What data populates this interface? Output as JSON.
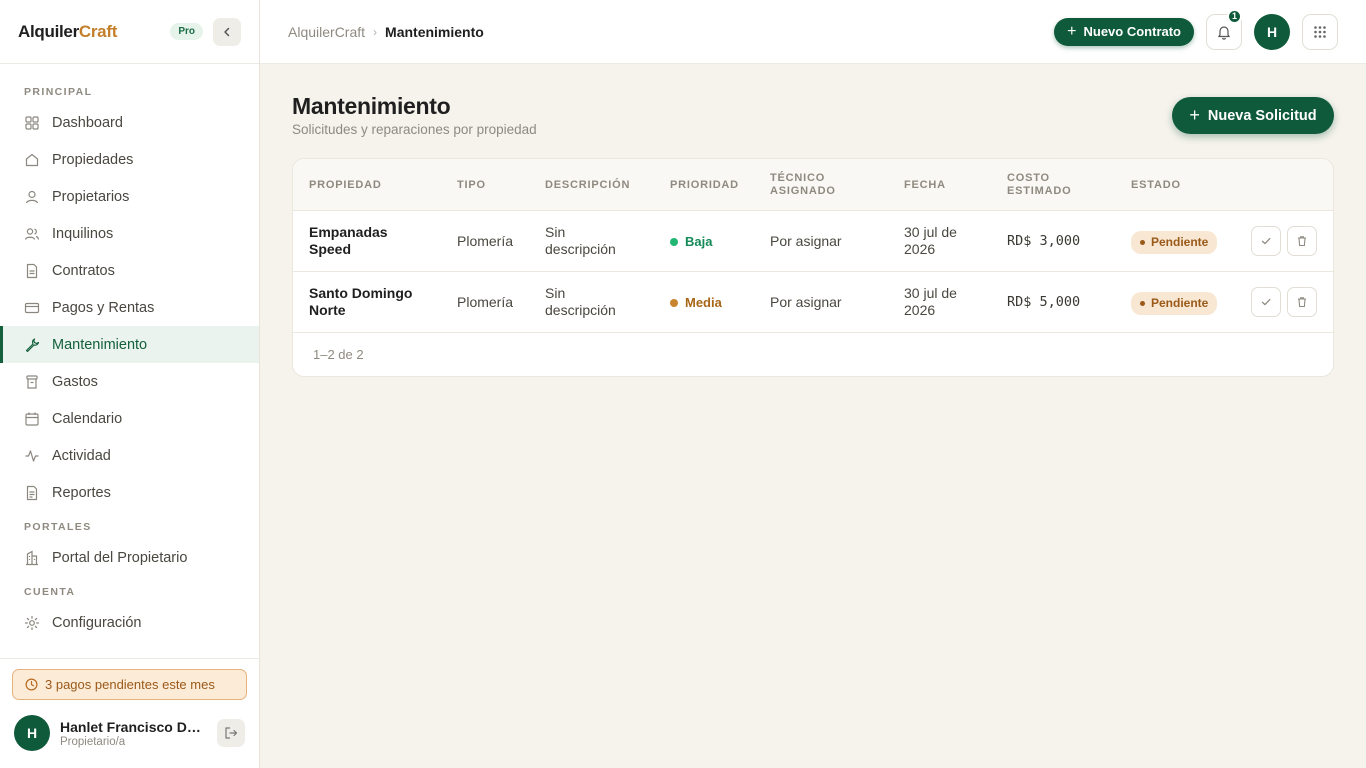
{
  "brand": {
    "part1": "Alquiler",
    "part2": "Craft",
    "plan": "Pro"
  },
  "sidebar": {
    "sections": [
      {
        "label": "PRINCIPAL"
      },
      {
        "label": "PORTALES"
      },
      {
        "label": "CUENTA"
      }
    ],
    "items": [
      {
        "label": "Dashboard",
        "icon": "grid-icon"
      },
      {
        "label": "Propiedades",
        "icon": "home-icon"
      },
      {
        "label": "Propietarios",
        "icon": "user-icon"
      },
      {
        "label": "Inquilinos",
        "icon": "users-icon"
      },
      {
        "label": "Contratos",
        "icon": "document-icon"
      },
      {
        "label": "Pagos y Rentas",
        "icon": "credit-card-icon"
      },
      {
        "label": "Mantenimiento",
        "icon": "wrench-icon",
        "active": true
      },
      {
        "label": "Gastos",
        "icon": "receipt-icon"
      },
      {
        "label": "Calendario",
        "icon": "calendar-icon"
      },
      {
        "label": "Actividad",
        "icon": "activity-icon"
      },
      {
        "label": "Reportes",
        "icon": "report-icon"
      },
      {
        "label": "Portal del Propietario",
        "icon": "building-icon"
      },
      {
        "label": "Configuración",
        "icon": "gear-icon"
      }
    ],
    "alert": "3 pagos pendientes este mes",
    "user": {
      "initial": "H",
      "name": "Hanlet Francisco De León",
      "role": "Propietario/a"
    }
  },
  "header": {
    "breadcrumb_root": "AlquilerCraft",
    "breadcrumb_current": "Mantenimiento",
    "new_contract": "Nuevo Contrato",
    "notifications": "1",
    "avatar_initial": "H"
  },
  "main": {
    "title": "Mantenimiento",
    "subtitle": "Solicitudes y reparaciones por propiedad",
    "new_request": "Nueva Solicitud",
    "columns": [
      "PROPIEDAD",
      "TIPO",
      "DESCRIPCIÓN",
      "PRIORIDAD",
      "TÉCNICO\nASIGNADO",
      "FECHA",
      "COSTO\nESTIMADO",
      "ESTADO"
    ],
    "rows": [
      {
        "propiedad": "Empanadas Speed",
        "tipo": "Plomería",
        "descripcion": "Sin descripción",
        "prioridad": "Baja",
        "tecnico": "Por asignar",
        "fecha": "30 jul de 2026",
        "costo": "RD$ 3,000",
        "estado": "Pendiente"
      },
      {
        "propiedad": "Santo Domingo Norte",
        "tipo": "Plomería",
        "descripcion": "Sin descripción",
        "prioridad": "Media",
        "tecnico": "Por asignar",
        "fecha": "30 jul de 2026",
        "costo": "RD$ 5,000",
        "estado": "Pendiente"
      }
    ],
    "pagination": "1–2 de 2"
  },
  "colors": {
    "primary": "#0f5a3a",
    "accent": "#c47f2a",
    "background": "#f6f3ed"
  }
}
